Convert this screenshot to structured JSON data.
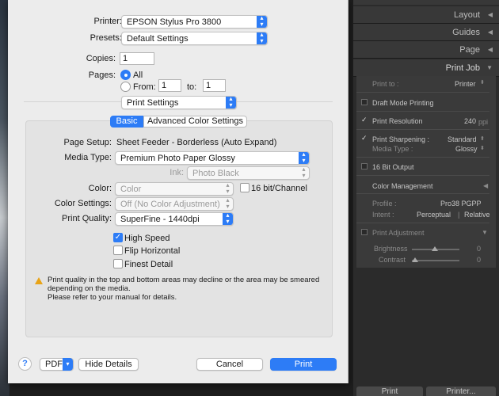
{
  "dialog": {
    "printer_label": "Printer:",
    "printer_value": "EPSON Stylus Pro 3800",
    "presets_label": "Presets:",
    "presets_value": "Default Settings",
    "copies_label": "Copies:",
    "copies_value": "1",
    "pages_label": "Pages:",
    "pages_all": "All",
    "pages_from": "From:",
    "pages_from_value": "1",
    "pages_to": "to:",
    "pages_to_value": "1",
    "section_value": "Print Settings",
    "tabs": [
      "Basic",
      "Advanced Color Settings"
    ],
    "page_setup_label": "Page Setup:",
    "page_setup_value": "Sheet Feeder - Borderless (Auto Expand)",
    "media_type_label": "Media Type:",
    "media_type_value": "Premium Photo Paper Glossy",
    "ink_label": "Ink:",
    "ink_value": "Photo Black",
    "color_label": "Color:",
    "color_value": "Color",
    "bit_label": "16 bit/Channel",
    "color_settings_label": "Color Settings:",
    "color_settings_value": "Off (No Color Adjustment)",
    "print_quality_label": "Print Quality:",
    "print_quality_value": "SuperFine - 1440dpi",
    "high_speed": "High Speed",
    "flip_horizontal": "Flip Horizontal",
    "finest_detail": "Finest Detail",
    "warning_line1": "Print quality in the top and bottom areas may decline or the area may be smeared",
    "warning_line2": "depending on the media.",
    "warning_line3": "Please refer to your manual for details.",
    "help": "?",
    "pdf": "PDF",
    "hide_details": "Hide Details",
    "cancel": "Cancel",
    "print": "Print"
  },
  "lightroom": {
    "headers": [
      "Layout",
      "Guides",
      "Page",
      "Print Job"
    ],
    "print_to_label": "Print to :",
    "print_to_value": "Printer",
    "draft_mode": "Draft Mode Printing",
    "print_resolution": "Print Resolution",
    "print_resolution_value": "240",
    "ppi": "ppi",
    "print_sharpening": "Print Sharpening :",
    "print_sharpening_value": "Standard",
    "media_type_label": "Media Type :",
    "media_type_value": "Glossy",
    "bit_output": "16 Bit Output",
    "color_management": "Color Management",
    "profile_label": "Profile :",
    "profile_value": "Pro38 PGPP",
    "intent_label": "Intent :",
    "intent_perceptual": "Perceptual",
    "intent_relative": "Relative",
    "print_adjustment": "Print Adjustment",
    "brightness": "Brightness",
    "brightness_value": "0",
    "contrast": "Contrast",
    "contrast_value": "0",
    "bottom_left": "Print",
    "bottom_right": "Printer..."
  }
}
